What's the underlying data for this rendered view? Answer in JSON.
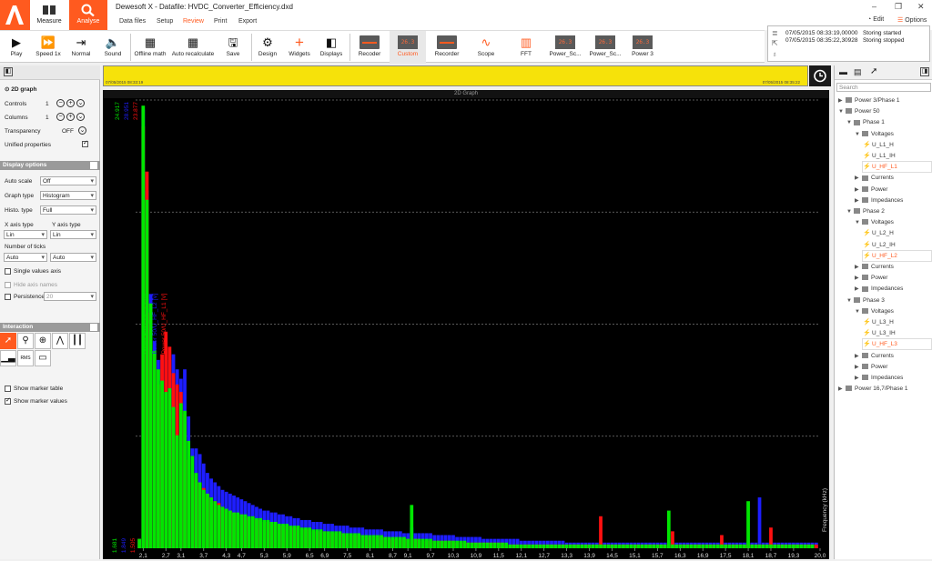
{
  "app": {
    "title": "Dewesoft X - Datafile: HVDC_Converter_Efficiency.dxd",
    "modes": [
      {
        "label": "Measure"
      },
      {
        "label": "Analyse"
      }
    ],
    "tabs": [
      "Data files",
      "Setup",
      "Review",
      "Print",
      "Export"
    ],
    "active_tab": "Review",
    "edit_label": "Edit",
    "options_label": "Options",
    "accent": "#ff5a1f"
  },
  "toolbar": {
    "items": [
      {
        "label": "Play",
        "icon": "play-icon"
      },
      {
        "label": "Speed 1x",
        "icon": "fast-forward-icon"
      },
      {
        "label": "Normal",
        "icon": "normal-icon"
      },
      {
        "label": "Sound",
        "icon": "sound-icon"
      },
      {
        "label": "Offline math",
        "icon": "calculator-icon"
      },
      {
        "label": "Auto recalculate",
        "icon": "recalc-icon"
      },
      {
        "label": "Save",
        "icon": "save-icon"
      },
      {
        "label": "Design",
        "icon": "gear-icon"
      },
      {
        "label": "Widgets",
        "icon": "plus-icon"
      },
      {
        "label": "Displays",
        "icon": "displays-icon"
      },
      {
        "label": "Recoder",
        "icon": "recorder-icon"
      },
      {
        "label": "Custom",
        "icon": "digital-icon"
      },
      {
        "label": "Recorder",
        "icon": "recorder-icon"
      },
      {
        "label": "Scope",
        "icon": "scope-icon"
      },
      {
        "label": "FFT",
        "icon": "fft-icon"
      },
      {
        "label": "Power_Sc...",
        "icon": "digital-icon"
      },
      {
        "label": "Power_Sc...",
        "icon": "digital-icon"
      },
      {
        "label": "Power 3",
        "icon": "digital-icon"
      }
    ],
    "digital_text": "26.3"
  },
  "event_log": [
    {
      "time": "07/05/2015 08:33:19,00000",
      "text": "Storing started"
    },
    {
      "time": "07/05/2015 08:35:22,30928",
      "text": "Storing stopped"
    }
  ],
  "left_panel": {
    "widget_title": "2D graph",
    "controls": {
      "label": "Controls",
      "value": "1"
    },
    "columns": {
      "label": "Columns",
      "value": "1"
    },
    "transparency": {
      "label": "Transparency",
      "value": "OFF"
    },
    "unified": {
      "label": "Unified properties",
      "checked": true
    },
    "display_options": {
      "title": "Display options",
      "auto_scale": {
        "label": "Auto scale",
        "value": "Off"
      },
      "graph_type": {
        "label": "Graph type",
        "value": "Histogram"
      },
      "histo_type": {
        "label": "Histo. type",
        "value": "Full"
      },
      "x_axis_type": {
        "label": "X axis type",
        "value": "Lin"
      },
      "y_axis_type": {
        "label": "Y axis type",
        "value": "Lin"
      },
      "ticks": {
        "label": "Number of ticks",
        "x": "Auto",
        "y": "Auto"
      },
      "single_values": {
        "label": "Single values axis",
        "checked": false
      },
      "hide_axis": {
        "label": "Hide axis names",
        "checked": false
      },
      "persistence": {
        "label": "Persistence",
        "value": "20",
        "checked": false
      }
    },
    "interaction": {
      "title": "Interaction",
      "rms_label": "RMS",
      "show_marker_table": {
        "label": "Show marker table",
        "checked": false
      },
      "show_marker_values": {
        "label": "Show marker values",
        "checked": true
      }
    }
  },
  "timeline": {
    "start": "07/05/2015 08:33:19",
    "end": "07/05/2015 08:35:22",
    "color": "#f6e20a"
  },
  "graph": {
    "title": "2D Graph",
    "y_top_left": "24.917",
    "y_top_mid": "28.951",
    "y_top_right": "23.877",
    "y_bottom_left": "1.681",
    "y_bottom_mid": "1.849",
    "y_bottom_right": "1.505"
  },
  "chart_data": {
    "type": "bar",
    "title": "2D Graph",
    "xlabel": "Frequency (kHz)",
    "ylabel": "",
    "x_tick_labels": [
      "2,1",
      "2,7",
      "3,1",
      "3,7",
      "4,3",
      "4,7",
      "5,3",
      "5,9",
      "6,5",
      "6,9",
      "7,5",
      "8,1",
      "8,7",
      "9,1",
      "9,7",
      "10,3",
      "10,9",
      "11,5",
      "12,1",
      "12,7",
      "13,3",
      "13,9",
      "14,5",
      "15,1",
      "15,7",
      "16,3",
      "16,9",
      "17,5",
      "18,1",
      "18,7",
      "19,3",
      "20,0"
    ],
    "xlim": [
      1.9,
      20.0
    ],
    "ylim": [
      1.5,
      25.3
    ],
    "grid": true,
    "series": [
      {
        "name": "Power 50/U_HF_L3 [V]",
        "color": "#00e600"
      },
      {
        "name": "Power 50/U_HF_L2 [V]",
        "color": "#1e1eff"
      },
      {
        "name": "Power 50/U_HF_L1 [V]",
        "color": "#ff1010"
      }
    ],
    "x": [
      2.0,
      2.1,
      2.2,
      2.3,
      2.4,
      2.5,
      2.6,
      2.7,
      2.8,
      2.9,
      3.0,
      3.1,
      3.2,
      3.3,
      3.4,
      3.5,
      3.6,
      3.7,
      3.8,
      3.9,
      4.0,
      4.1,
      4.2,
      4.3,
      4.4,
      4.5,
      4.6,
      4.7,
      4.8,
      4.9,
      5.0,
      5.1,
      5.2,
      5.3,
      5.4,
      5.5,
      5.6,
      5.7,
      5.8,
      5.9,
      6.0,
      6.1,
      6.2,
      6.3,
      6.4,
      6.5,
      6.6,
      6.7,
      6.8,
      6.9,
      7.0,
      7.1,
      7.2,
      7.3,
      7.4,
      7.5,
      7.6,
      7.7,
      7.8,
      7.9,
      8.0,
      8.1,
      8.2,
      8.3,
      8.4,
      8.5,
      8.6,
      8.7,
      8.8,
      8.9,
      9.0,
      9.1,
      9.2,
      9.3,
      9.4,
      9.5,
      9.6,
      9.7,
      9.8,
      9.9,
      10.0,
      10.1,
      10.2,
      10.3,
      10.4,
      10.5,
      10.6,
      10.7,
      10.8,
      10.9,
      11.0,
      11.1,
      11.2,
      11.3,
      11.4,
      11.5,
      11.6,
      11.7,
      11.8,
      11.9,
      12.0,
      12.1,
      12.2,
      12.3,
      12.4,
      12.5,
      12.6,
      12.7,
      12.8,
      12.9,
      13.0,
      13.1,
      13.2,
      13.3,
      13.4,
      13.5,
      13.6,
      13.7,
      13.8,
      13.9,
      14.0,
      14.1,
      14.2,
      14.3,
      14.4,
      14.5,
      14.6,
      14.7,
      14.8,
      14.9,
      15.0,
      15.1,
      15.2,
      15.3,
      15.4,
      15.5,
      15.6,
      15.7,
      15.8,
      15.9,
      16.0,
      16.1,
      16.2,
      16.3,
      16.4,
      16.5,
      16.6,
      16.7,
      16.8,
      16.9,
      17.0,
      17.1,
      17.2,
      17.3,
      17.4,
      17.5,
      17.6,
      17.7,
      17.8,
      17.9,
      18.0,
      18.1,
      18.2,
      18.3,
      18.4,
      18.5,
      18.6,
      18.7,
      18.8,
      18.9,
      19.0,
      19.1,
      19.2,
      19.3,
      19.4,
      19.5,
      19.6,
      19.7,
      19.8,
      19.9
    ],
    "l3": [
      2.0,
      25.0,
      20.0,
      14.5,
      12.0,
      11.0,
      10.4,
      9.8,
      10.0,
      9.0,
      7.5,
      9.2,
      8.8,
      7.2,
      6.4,
      5.5,
      5.0,
      4.6,
      4.4,
      4.2,
      4.0,
      3.8,
      3.7,
      3.6,
      3.5,
      3.4,
      3.4,
      3.3,
      3.3,
      3.2,
      3.2,
      3.1,
      3.1,
      3.0,
      3.0,
      2.9,
      2.9,
      2.8,
      2.8,
      2.8,
      2.7,
      2.7,
      2.7,
      2.6,
      2.6,
      2.6,
      2.5,
      2.5,
      2.5,
      2.4,
      2.4,
      2.4,
      2.4,
      2.4,
      2.3,
      2.3,
      2.3,
      2.3,
      2.3,
      2.2,
      2.2,
      2.2,
      2.2,
      2.2,
      2.2,
      2.1,
      2.1,
      2.1,
      2.1,
      2.1,
      2.1,
      2.0,
      3.8,
      2.0,
      2.0,
      2.0,
      2.0,
      2.0,
      1.9,
      1.9,
      1.9,
      1.9,
      1.9,
      1.9,
      1.9,
      1.9,
      1.9,
      1.8,
      1.8,
      1.8,
      1.8,
      1.8,
      1.8,
      1.8,
      1.8,
      1.8,
      1.8,
      1.8,
      1.7,
      1.7,
      1.7,
      1.7,
      1.7,
      1.7,
      1.7,
      1.7,
      1.7,
      1.7,
      1.7,
      1.7,
      1.7,
      1.7,
      1.7,
      1.7,
      1.7,
      1.7,
      1.7,
      1.7,
      1.7,
      1.7,
      1.7,
      1.7,
      1.7,
      1.7,
      1.7,
      1.7,
      1.7,
      1.7,
      1.7,
      1.7,
      1.7,
      1.7,
      1.7,
      1.7,
      1.7,
      1.7,
      1.7,
      1.7,
      1.7,
      1.7,
      3.5,
      1.7,
      1.7,
      1.7,
      1.7,
      1.7,
      1.7,
      1.7,
      1.7,
      1.7,
      1.7,
      1.7,
      1.7,
      1.7,
      1.7,
      1.7,
      1.7,
      1.7,
      1.7,
      1.7,
      1.7,
      4.0,
      1.7,
      1.7,
      1.7,
      1.7,
      1.7,
      1.7,
      1.7,
      1.7,
      1.7,
      1.7,
      1.7,
      1.7,
      1.7,
      1.7,
      1.7,
      1.7,
      1.7
    ],
    "l2": [
      2.0,
      24.8,
      20.5,
      15.0,
      12.5,
      11.5,
      11.5,
      11.5,
      11.5,
      11.8,
      11.0,
      10.5,
      11.0,
      8.5,
      6.8,
      6.8,
      6.5,
      6.0,
      5.5,
      5.2,
      5.0,
      4.8,
      4.6,
      4.5,
      4.4,
      4.3,
      4.2,
      4.1,
      4.0,
      3.9,
      3.8,
      3.7,
      3.6,
      3.5,
      3.5,
      3.4,
      3.4,
      3.3,
      3.3,
      3.2,
      3.2,
      3.1,
      3.1,
      3.0,
      3.0,
      3.0,
      2.9,
      2.9,
      2.9,
      2.8,
      2.8,
      2.8,
      2.7,
      2.7,
      2.7,
      2.7,
      2.6,
      2.6,
      2.6,
      2.6,
      2.5,
      2.5,
      2.5,
      2.5,
      2.5,
      2.4,
      2.4,
      2.4,
      2.4,
      2.4,
      2.3,
      2.3,
      2.6,
      2.3,
      2.3,
      2.3,
      2.3,
      2.3,
      2.2,
      2.2,
      2.2,
      2.2,
      2.2,
      2.2,
      2.1,
      2.1,
      2.1,
      2.1,
      2.1,
      2.1,
      2.1,
      2.0,
      2.0,
      2.0,
      2.0,
      2.0,
      2.0,
      2.0,
      2.0,
      2.0,
      2.0,
      1.9,
      1.9,
      1.9,
      1.9,
      1.9,
      1.9,
      1.9,
      1.9,
      1.9,
      1.9,
      1.9,
      1.9,
      1.8,
      1.8,
      1.8,
      1.8,
      1.8,
      1.8,
      1.8,
      1.8,
      1.8,
      1.8,
      1.8,
      1.8,
      1.8,
      1.8,
      1.8,
      1.8,
      1.8,
      1.8,
      1.8,
      1.8,
      1.8,
      1.8,
      1.8,
      1.8,
      1.8,
      1.8,
      1.8,
      1.8,
      1.8,
      1.8,
      1.8,
      1.8,
      1.8,
      1.8,
      1.8,
      1.8,
      1.8,
      1.8,
      1.8,
      1.8,
      1.8,
      1.8,
      1.8,
      1.8,
      1.8,
      1.8,
      1.8,
      1.8,
      1.8,
      1.8,
      1.8,
      4.2,
      1.8,
      1.8,
      1.8,
      1.8,
      1.8,
      1.8,
      1.8,
      1.8,
      1.8,
      1.8,
      1.8,
      1.8,
      1.8,
      1.8,
      1.8,
      1.8
    ],
    "l1": [
      2.0,
      23.9,
      21.5,
      14.0,
      12.0,
      10.2,
      11.8,
      13.0,
      12.2,
      10.8,
      10.2,
      9.8,
      8.6,
      6.2,
      5.5,
      5.2,
      5.0,
      4.7,
      4.4,
      4.2,
      4.0,
      3.9,
      3.7,
      3.6,
      3.5,
      3.4,
      3.3,
      3.3,
      3.2,
      3.1,
      3.1,
      3.0,
      3.0,
      2.9,
      2.9,
      2.8,
      2.8,
      2.7,
      2.7,
      2.7,
      2.6,
      2.6,
      2.6,
      2.5,
      2.5,
      2.5,
      2.4,
      2.4,
      2.4,
      2.4,
      2.3,
      2.3,
      2.3,
      2.3,
      2.3,
      2.2,
      2.2,
      2.2,
      2.2,
      2.2,
      2.1,
      2.1,
      2.1,
      2.1,
      2.1,
      2.1,
      2.0,
      2.0,
      2.0,
      2.0,
      2.0,
      2.0,
      2.0,
      2.0,
      2.0,
      1.9,
      1.9,
      1.9,
      1.9,
      1.9,
      1.9,
      1.9,
      1.9,
      1.9,
      1.8,
      1.8,
      1.8,
      1.8,
      1.8,
      1.8,
      1.8,
      1.8,
      1.8,
      1.8,
      1.8,
      1.8,
      1.8,
      1.7,
      1.7,
      1.7,
      1.7,
      1.7,
      1.7,
      1.7,
      1.7,
      1.7,
      1.7,
      1.7,
      1.7,
      1.7,
      1.7,
      1.7,
      1.7,
      1.7,
      1.7,
      1.7,
      1.7,
      1.7,
      1.7,
      1.7,
      1.7,
      1.7,
      3.2,
      1.7,
      1.7,
      1.7,
      1.7,
      1.7,
      1.7,
      1.7,
      1.7,
      1.7,
      1.7,
      1.7,
      1.7,
      1.7,
      1.7,
      1.7,
      1.7,
      1.7,
      1.7,
      2.4,
      1.7,
      1.7,
      1.7,
      1.7,
      1.7,
      1.7,
      1.7,
      1.7,
      1.7,
      1.7,
      1.7,
      1.7,
      2.2,
      1.7,
      1.7,
      1.7,
      1.7,
      1.7,
      1.7,
      1.7,
      1.7,
      1.7,
      1.7,
      1.7,
      1.7,
      2.6,
      1.7,
      1.7,
      1.7,
      1.7,
      1.7,
      1.7,
      1.7,
      1.7,
      1.7,
      1.7,
      1.7,
      1.7,
      2.3,
      1.7
    ]
  },
  "right_panel": {
    "search_placeholder": "Search",
    "tree": [
      {
        "label": "Power 3/Phase 1",
        "level": 0,
        "kind": "folder",
        "expanded": false
      },
      {
        "label": "Power 50",
        "level": 0,
        "kind": "folder",
        "expanded": true
      },
      {
        "label": "Phase 1",
        "level": 1,
        "kind": "folder",
        "expanded": true
      },
      {
        "label": "Voltages",
        "level": 2,
        "kind": "folder",
        "expanded": true
      },
      {
        "label": "U_L1_H",
        "level": 3,
        "kind": "channel"
      },
      {
        "label": "U_L1_IH",
        "level": 3,
        "kind": "channel"
      },
      {
        "label": "U_HF_L1",
        "level": 3,
        "kind": "channel",
        "selected": true
      },
      {
        "label": "Currents",
        "level": 2,
        "kind": "folder",
        "expanded": false
      },
      {
        "label": "Power",
        "level": 2,
        "kind": "folder",
        "expanded": false
      },
      {
        "label": "Impedances",
        "level": 2,
        "kind": "folder",
        "expanded": false
      },
      {
        "label": "Phase 2",
        "level": 1,
        "kind": "folder",
        "expanded": true
      },
      {
        "label": "Voltages",
        "level": 2,
        "kind": "folder",
        "expanded": true
      },
      {
        "label": "U_L2_H",
        "level": 3,
        "kind": "channel"
      },
      {
        "label": "U_L2_IH",
        "level": 3,
        "kind": "channel"
      },
      {
        "label": "U_HF_L2",
        "level": 3,
        "kind": "channel",
        "selected": true
      },
      {
        "label": "Currents",
        "level": 2,
        "kind": "folder",
        "expanded": false
      },
      {
        "label": "Power",
        "level": 2,
        "kind": "folder",
        "expanded": false
      },
      {
        "label": "Impedances",
        "level": 2,
        "kind": "folder",
        "expanded": false
      },
      {
        "label": "Phase 3",
        "level": 1,
        "kind": "folder",
        "expanded": true
      },
      {
        "label": "Voltages",
        "level": 2,
        "kind": "folder",
        "expanded": true
      },
      {
        "label": "U_L3_H",
        "level": 3,
        "kind": "channel"
      },
      {
        "label": "U_L3_IH",
        "level": 3,
        "kind": "channel"
      },
      {
        "label": "U_HF_L3",
        "level": 3,
        "kind": "channel",
        "selected": true
      },
      {
        "label": "Currents",
        "level": 2,
        "kind": "folder",
        "expanded": false
      },
      {
        "label": "Power",
        "level": 2,
        "kind": "folder",
        "expanded": false
      },
      {
        "label": "Impedances",
        "level": 2,
        "kind": "folder",
        "expanded": false
      },
      {
        "label": "Power 16,7/Phase 1",
        "level": 0,
        "kind": "folder",
        "expanded": false
      }
    ]
  }
}
